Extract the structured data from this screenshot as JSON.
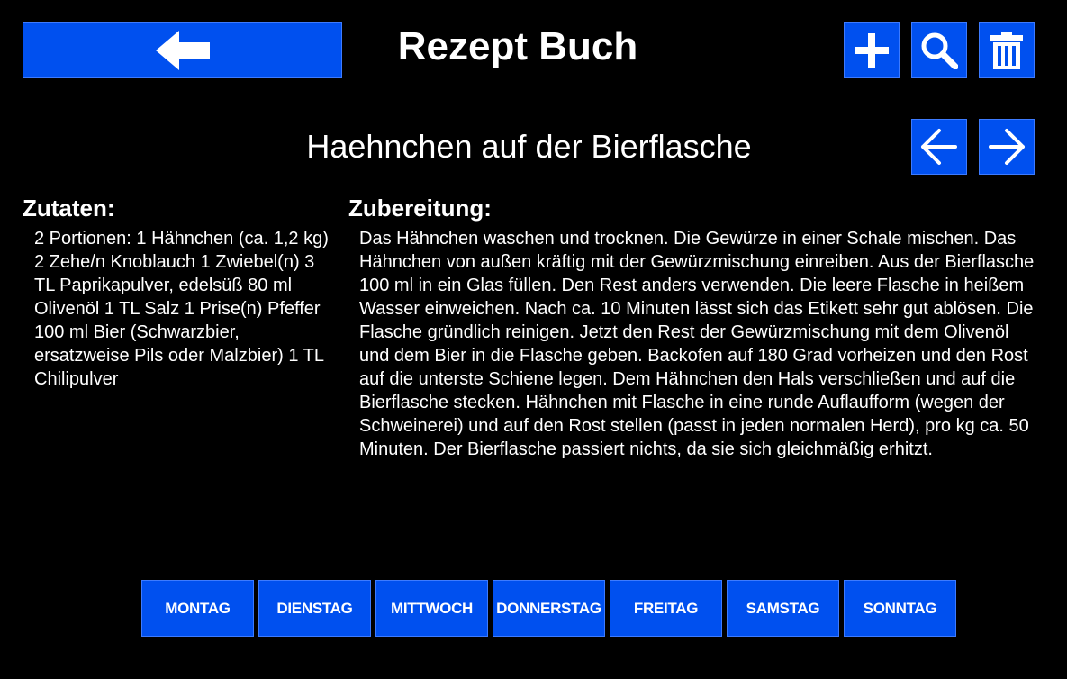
{
  "header": {
    "title": "Rezept Buch",
    "back_icon": "arrow-left-icon",
    "add_icon": "plus-icon",
    "search_icon": "search-icon",
    "delete_icon": "trash-icon"
  },
  "recipe": {
    "title": "Haehnchen auf der Bierflasche",
    "prev_icon": "arrow-left-icon",
    "next_icon": "arrow-right-icon",
    "ingredients_heading": "Zutaten:",
    "ingredients": "2 Portionen: 1 Hähnchen (ca. 1,2 kg) 2 Zehe/n Knoblauch 1 Zwiebel(n) 3 TL Paprikapulver, edelsüß 80 ml Olivenöl 1 TL Salz 1 Prise(n) Pfeffer 100 ml Bier (Schwarzbier, ersatzweise Pils oder Malzbier) 1 TL Chilipulver",
    "preparation_heading": "Zubereitung:",
    "preparation": "Das Hähnchen waschen und trocknen. Die Gewürze in einer Schale mischen. Das Hähnchen von außen kräftig mit der Gewürzmischung einreiben. Aus der Bierflasche 100 ml in ein Glas füllen. Den Rest anders verwenden. Die leere Flasche in heißem Wasser einweichen. Nach ca. 10 Minuten lässt sich das Etikett sehr gut ablösen. Die Flasche gründlich reinigen. Jetzt den Rest der Gewürzmischung mit dem Olivenöl und dem Bier in die Flasche geben. Backofen auf 180 Grad vorheizen und den Rost auf die unterste Schiene legen. Dem Hähnchen den Hals verschließen und auf die Bierflasche stecken. Hähnchen mit Flasche in eine runde Auflaufform (wegen der Schweinerei) und auf den Rost stellen (passt in jeden normalen Herd), pro kg ca. 50 Minuten. Der Bierflasche passiert nichts, da sie sich gleichmäßig erhitzt."
  },
  "days": [
    "MONTAG",
    "DIENSTAG",
    "MITTWOCH",
    "DONNERSTAG",
    "FREITAG",
    "SAMSTAG",
    "SONNTAG"
  ],
  "colors": {
    "background": "#000000",
    "button": "#0050ef",
    "text": "#ffffff"
  }
}
